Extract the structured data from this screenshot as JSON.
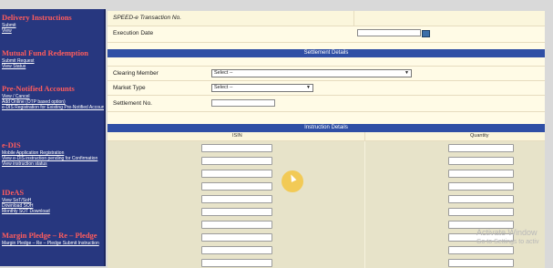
{
  "sidebar": {
    "sections": [
      {
        "title": "Delivery Instructions",
        "links": [
          "Submit",
          "View"
        ]
      },
      {
        "title": "Mutual Fund Redemption",
        "links": [
          "Submit Request",
          "View Status"
        ]
      },
      {
        "title": "Pre-Notified Accounts",
        "links": [
          "View / Cancel",
          "Add Online (OTP based option)",
          "e-DIS Registration for Existing Pre-Notified Accounts"
        ]
      },
      {
        "title": "e-DIS",
        "links": [
          "Mobile Application Registration",
          "View e-DIS instruction pending for Confirmation",
          "View instruction status"
        ]
      },
      {
        "title": "IDeAS",
        "links": [
          "View SoT/SoH",
          "Download SOH",
          "Monthly SOT Download"
        ]
      },
      {
        "title": "Margin Pledge – Re – Pledge",
        "links": [
          "Margin Pledge – Re – Pledge Submit Instruction"
        ]
      }
    ]
  },
  "form": {
    "transaction_no_label": "SPEED-e Transaction No.",
    "execution_date_label": "Execution Date",
    "settlement_header": "Settlement Details",
    "clearing_member_label": "Clearing Member",
    "clearing_member_value": "Select --",
    "market_type_label": "Market Type",
    "market_type_value": "Select --",
    "settlement_no_label": "Settlement No.",
    "instruction_header": "Instruction Details",
    "isin_header": "ISIN",
    "quantity_header": "Quantity"
  },
  "watermark": {
    "line1": "Activate Window",
    "line2": "Go to Settings to activ"
  },
  "colors": {
    "sidebar_bg": "#27377f",
    "section_title": "#ff5c5c",
    "header_bar": "#2f4fa5",
    "form_bg": "#fffbe6"
  }
}
